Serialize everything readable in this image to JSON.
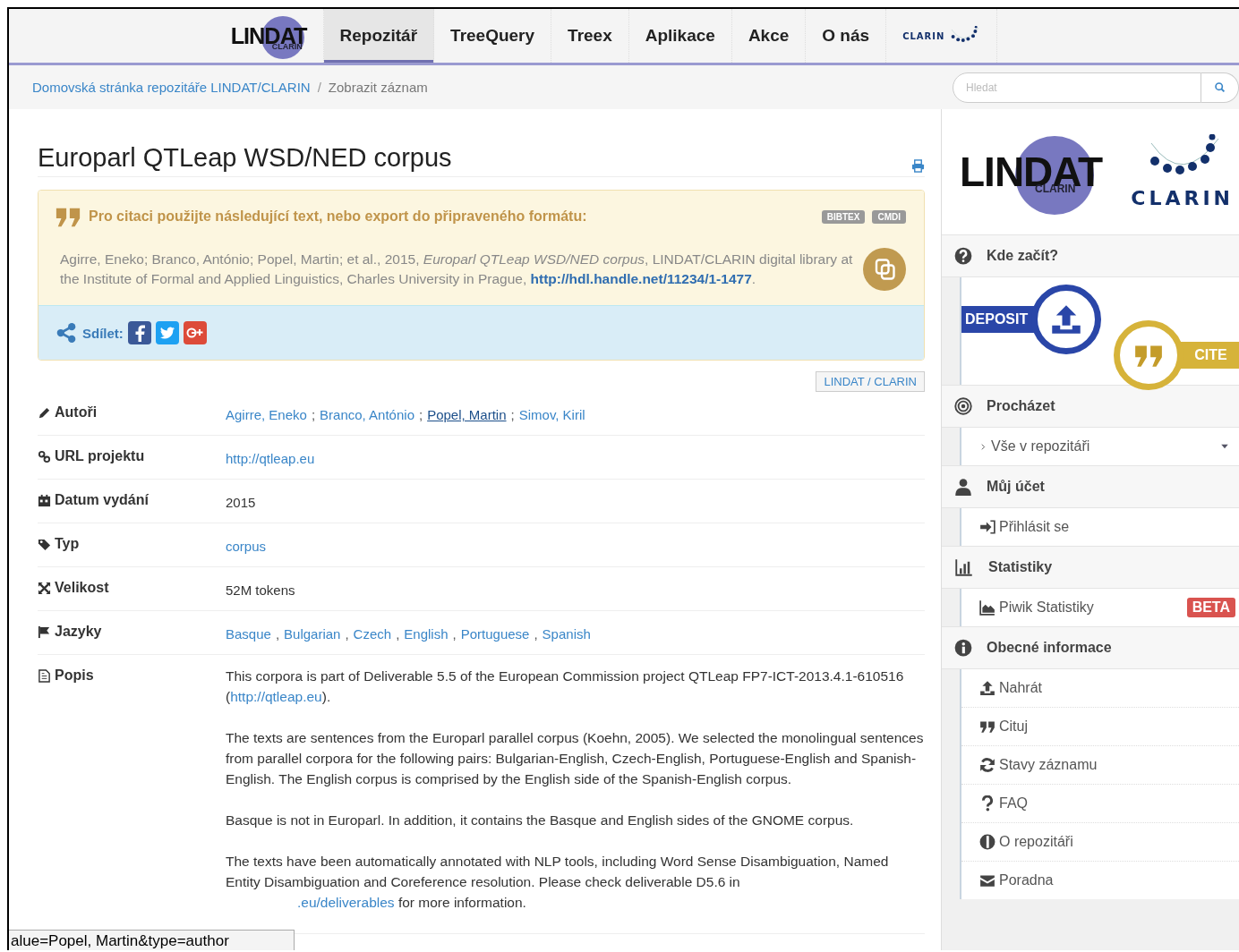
{
  "nav": {
    "logo": {
      "text": "LINDAT",
      "sub": "CLARIN"
    },
    "items": [
      {
        "label": "Repozitář",
        "selected": true
      },
      {
        "label": "TreeQuery",
        "selected": false
      },
      {
        "label": "Treex",
        "selected": false
      },
      {
        "label": "Aplikace",
        "selected": false
      },
      {
        "label": "Akce",
        "selected": false
      },
      {
        "label": "O nás",
        "selected": false
      }
    ],
    "partner_logo": "CLARIN"
  },
  "breadcrumb": [
    {
      "label": "Domovská stránka repozitáře LINDAT/CLARIN",
      "kind": "link"
    },
    {
      "label": "/",
      "kind": "separator"
    },
    {
      "label": "Zobrazit záznam",
      "kind": "current"
    }
  ],
  "search": {
    "placeholder": "Hledat"
  },
  "item": {
    "title": "Europarl QTLeap WSD/NED corpus",
    "citation": {
      "heading": "Pro citaci použijte následující text, nebo export do připraveného formátu:",
      "formats": [
        "BIBTEX",
        "CMDI"
      ],
      "text": "Agirre, Eneko; Branco, António; Popel, Martin; et al., 2015, *Europarl QTLeap WSD/NED corpus*, LINDAT/CLARIN digital library at the Institute of Formal and Applied Linguistics, Charles University in Prague,",
      "handle": "http://hdl.handle.net/11234/1-1477",
      "tail": "."
    },
    "share": {
      "label": "Sdílet:"
    },
    "collection": "LINDAT / CLARIN",
    "fields": [
      {
        "label": "Autoři",
        "kind": "links",
        "separator": ";",
        "values": [
          {
            "text": "Agirre, Eneko",
            "hovered": false
          },
          {
            "text": "Branco, António",
            "hovered": false
          },
          {
            "text": "Popel, Martin",
            "hovered": true
          },
          {
            "text": "Simov, Kiril",
            "hovered": false
          }
        ]
      },
      {
        "label": "URL projektu",
        "kind": "links",
        "values": [
          {
            "text": "http://qtleap.eu",
            "hovered": false
          }
        ]
      },
      {
        "label": "Datum vydání",
        "kind": "text",
        "value": "2015"
      },
      {
        "label": "Typ",
        "kind": "links",
        "values": [
          {
            "text": "corpus",
            "hovered": false
          }
        ]
      },
      {
        "label": "Velikost",
        "kind": "text",
        "value": "52M tokens"
      },
      {
        "label": "Jazyky",
        "kind": "links",
        "separator": ",",
        "values": [
          {
            "text": "Basque",
            "hovered": false
          },
          {
            "text": "Bulgarian",
            "hovered": false
          },
          {
            "text": "Czech",
            "hovered": false
          },
          {
            "text": "English",
            "hovered": false
          },
          {
            "text": "Portuguese",
            "hovered": false
          },
          {
            "text": "Spanish",
            "hovered": false
          }
        ]
      },
      {
        "label": "Popis",
        "kind": "description",
        "paragraphs": [
          {
            "kind": "inline_link",
            "text": "This corpora is part of Deliverable 5.5 of the European Commission project QTLeap FP7-ICT-2013.4.1-610516 (",
            "link": "http://qtleap.eu",
            "after": ")."
          },
          {
            "kind": "plain",
            "text": "The texts are sentences from the Europarl parallel corpus (Koehn, 2005). We selected the monolingual sentences from parallel corpora for the following pairs: Bulgarian-English, Czech-English, Portuguese-English and Spanish-English. The English corpus is comprised by the English side of the Spanish-English corpus."
          },
          {
            "kind": "plain",
            "text": "Basque is not in Europarl. In addition, it contains the Basque and English sides of the GNOME corpus."
          },
          {
            "kind": "link_below",
            "text": "The texts have been automatically annotated with NLP tools, including Word Sense Disambiguation, Named Entity Disambiguation and Coreference resolution. Please check deliverable D5.6 in",
            "link": ".eu/deliverables",
            "after": " for more information."
          }
        ]
      }
    ]
  },
  "sidebar": {
    "logo": {
      "text": "LINDAT",
      "sub": "CLARIN"
    },
    "partner_logo": "CLARIN",
    "sections": [
      {
        "title": "Kde začít?",
        "kind": "badges",
        "badges": [
          {
            "label": "DEPOSIT",
            "kind": "deposit"
          },
          {
            "label": "CITE",
            "kind": "cite"
          }
        ]
      },
      {
        "title": "Procházet",
        "kind": "list",
        "items": [
          {
            "label": "Vše v repozitáři",
            "kind": "dropdown"
          }
        ]
      },
      {
        "title": "Můj účet",
        "kind": "list",
        "items": [
          {
            "label": "Přihlásit se",
            "kind": "link"
          }
        ]
      },
      {
        "title": "Statistiky",
        "kind": "list",
        "items": [
          {
            "label": "Piwik Statistiky",
            "kind": "link",
            "badge": "BETA"
          }
        ]
      },
      {
        "title": "Obecné informace",
        "kind": "list",
        "items": [
          {
            "label": "Nahrát",
            "kind": "link"
          },
          {
            "label": "Cituj",
            "kind": "link"
          },
          {
            "label": "Stavy záznamu",
            "kind": "link"
          },
          {
            "label": "FAQ",
            "kind": "link"
          },
          {
            "label": "O repozitáři",
            "kind": "link"
          },
          {
            "label": "Poradna",
            "kind": "link"
          }
        ]
      }
    ]
  },
  "status_tooltip": "alue=Popel, Martin&type=author"
}
